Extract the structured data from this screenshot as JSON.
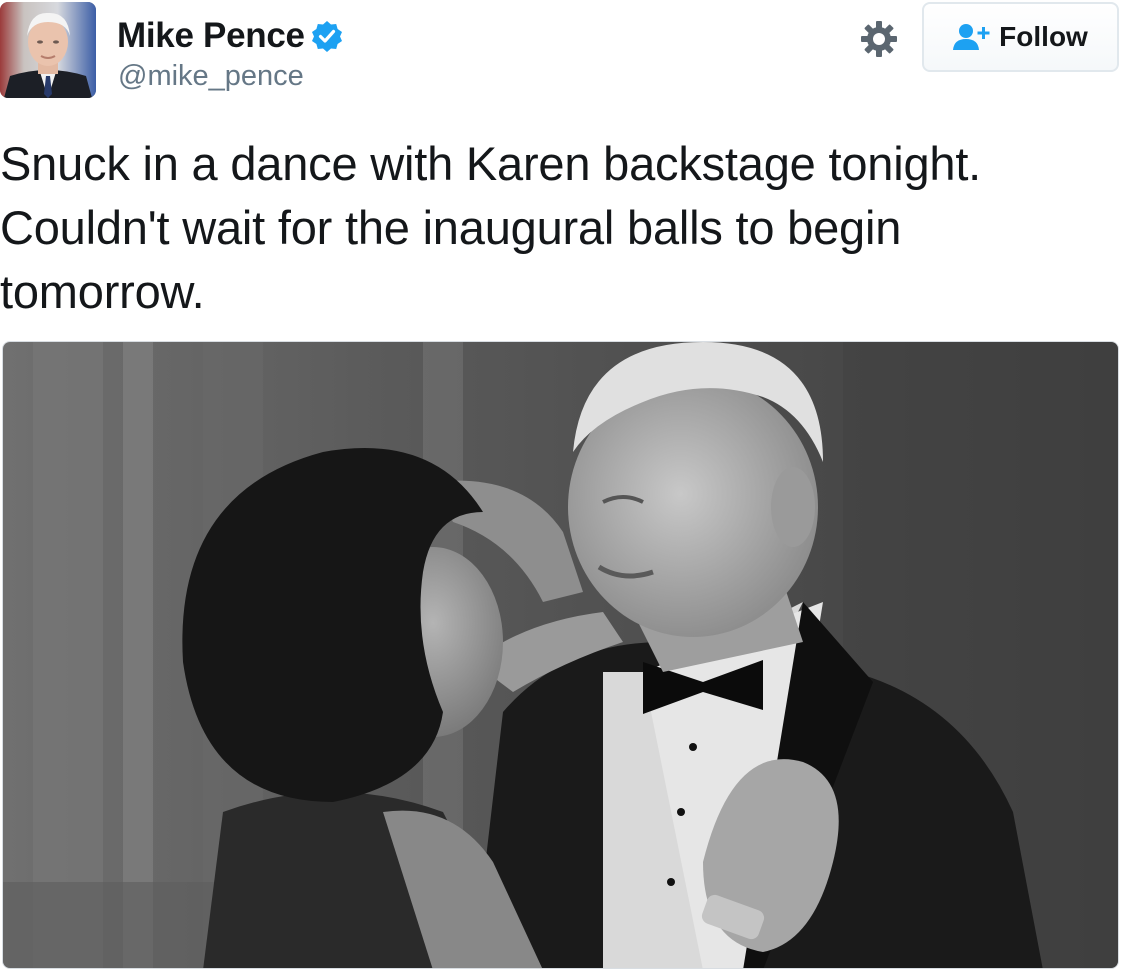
{
  "author": {
    "display_name": "Mike Pence",
    "handle": "@mike_pence",
    "verified": true,
    "verified_color": "#1da1f2"
  },
  "actions": {
    "follow_label": "Follow",
    "follow_icon": "add-user-icon",
    "settings_icon": "gear-icon",
    "accent_color": "#1da1f2"
  },
  "tweet": {
    "text": "Snuck in a dance with Karen backstage tonight. Couldn't wait for the inaugural balls to begin tomorrow."
  },
  "media": {
    "type": "photo",
    "style": "black-and-white"
  }
}
